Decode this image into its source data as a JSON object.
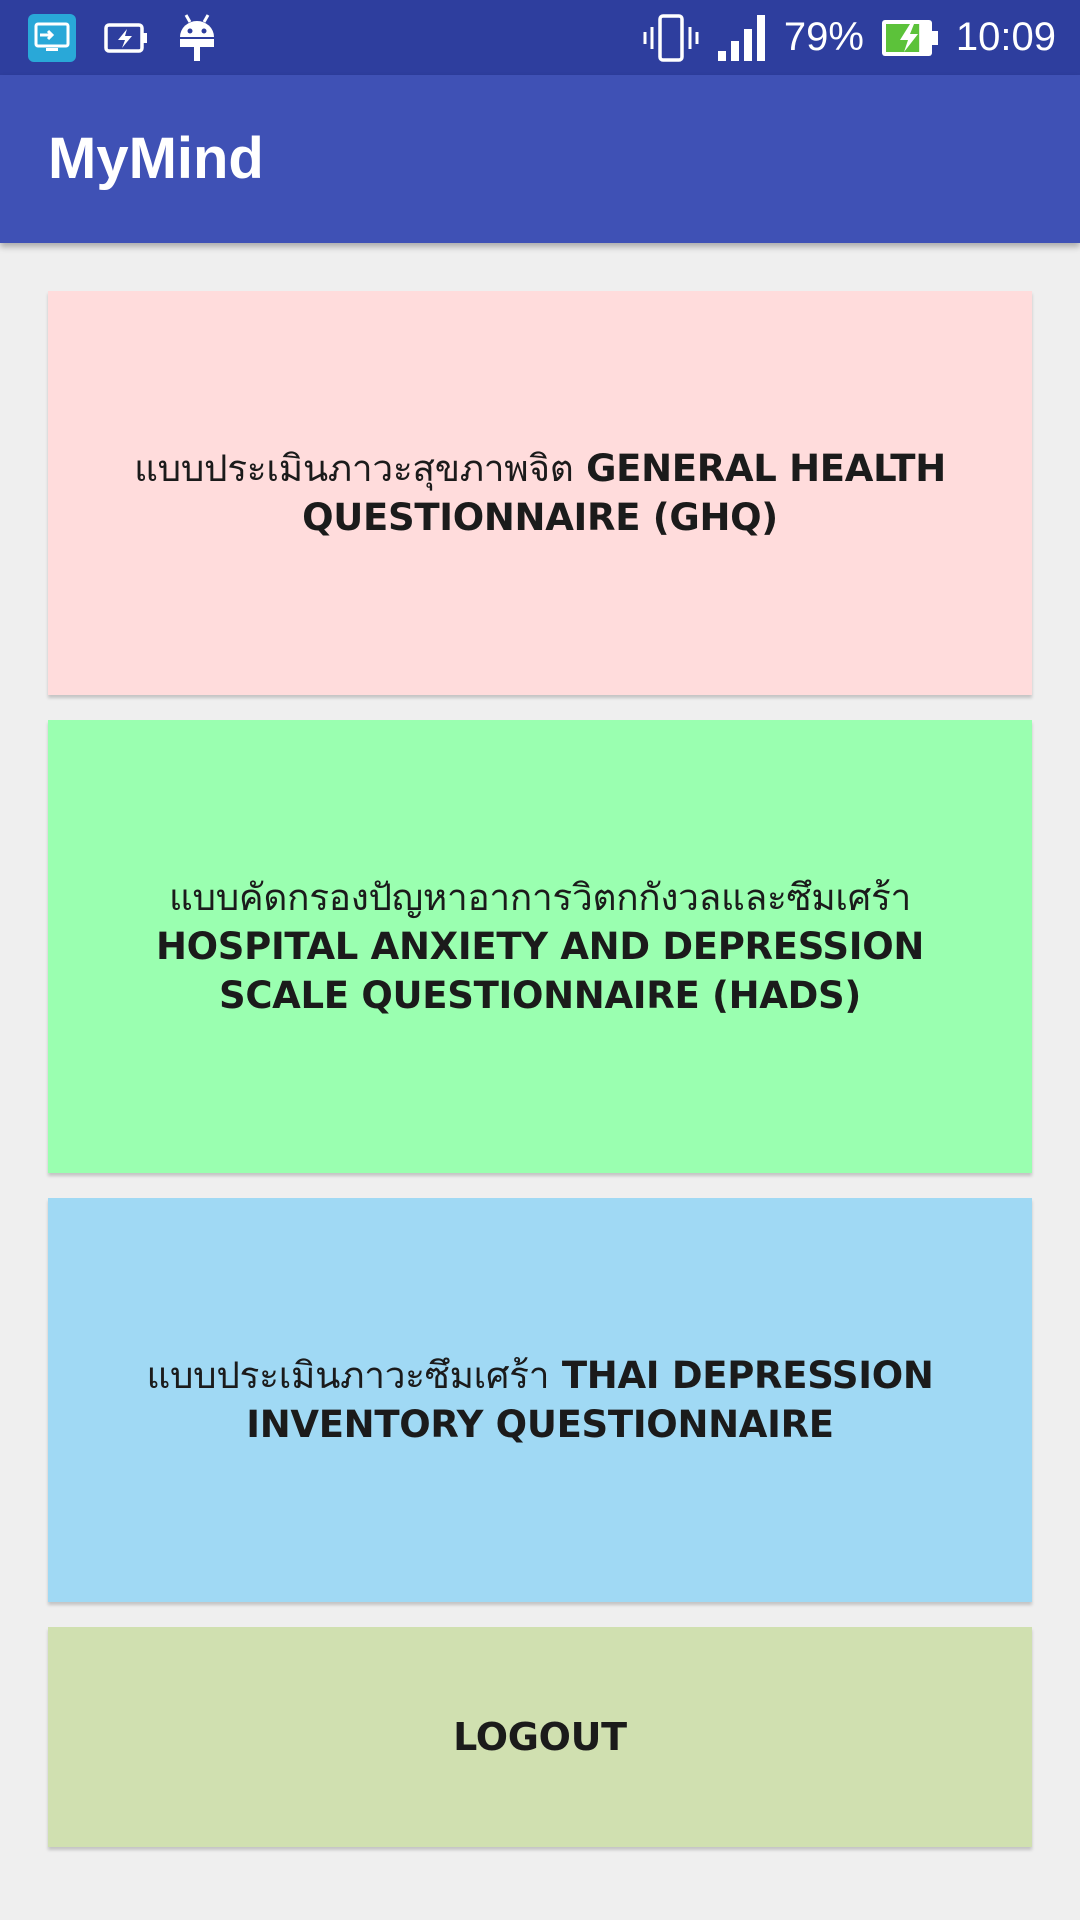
{
  "status_bar": {
    "icons_left": [
      "screen-mirror-icon",
      "battery-saver-icon",
      "android-debug-icon"
    ],
    "icons_right": [
      "vibrate-icon",
      "signal-icon"
    ],
    "battery_percent": "79%",
    "battery_level": 0.79,
    "time": "10:09",
    "colors": {
      "background": "#2e3e9e"
    }
  },
  "app_bar": {
    "title": "MyMind",
    "color": "#3f51b5"
  },
  "menu": {
    "ghq": {
      "label_thai": "แบบประเมินภาวะสุขภาพจิต",
      "label_en": "GENERAL HEALTH QUESTIONNAIRE (GHQ)",
      "color": "#ffdcdc"
    },
    "hads": {
      "label_thai": "แบบคัดกรองปัญหาอาการวิตกกังวลและซึมเศร้า",
      "label_en": "HOSPITAL ANXIETY AND DEPRESSION SCALE QUESTIONNAIRE (HADS)",
      "color": "#9affb0"
    },
    "tdi": {
      "label_thai": "แบบประเมินภาวะซึมเศร้า",
      "label_en": "THAI DEPRESSION INVENTORY QUESTIONNAIRE",
      "color": "#a0d9f4"
    },
    "logout": {
      "label": "LOGOUT",
      "color": "#d0e0b0"
    }
  }
}
